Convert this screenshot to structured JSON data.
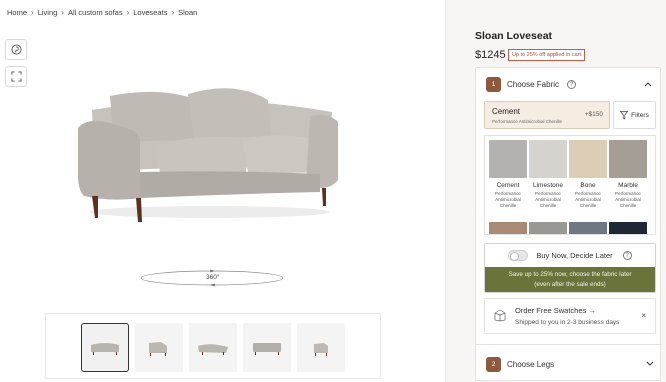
{
  "breadcrumb": [
    "Home",
    "Living",
    "All custom sofas",
    "Loveseats",
    "Sloan"
  ],
  "viewer": {
    "rotate_label": "360°"
  },
  "product": {
    "title": "Sloan Loveseat",
    "price": "$1245",
    "promo": "Up to 25% off applied in cart"
  },
  "step1": {
    "number": "1",
    "label": "Choose Fabric",
    "help": "?",
    "selected": {
      "name": "Cement",
      "desc": "Performance Antimicrobial Chenille",
      "price": "+$150"
    },
    "filters_label": "Filters",
    "swatches": [
      {
        "name": "Cement",
        "desc": [
          "Performance",
          "Antimicrobial",
          "Chenille"
        ],
        "color": "#b4b2ae"
      },
      {
        "name": "Limestone",
        "desc": [
          "Performance",
          "Antimicrobial",
          "Chenille"
        ],
        "color": "#d6d3ce"
      },
      {
        "name": "Bone",
        "desc": [
          "Performance",
          "Antimicrobial",
          "Chenille"
        ],
        "color": "#dccdb6"
      },
      {
        "name": "Marble",
        "desc": [
          "Performance",
          "Antimicrobial",
          "Chenille"
        ],
        "color": "#a59e95"
      }
    ],
    "next_row_colors": [
      "#a88b73",
      "#9a9894",
      "#6f7782",
      "#1d2736"
    ]
  },
  "buy_now": {
    "label": "Buy Now, Decide Later",
    "help": "?",
    "banner_line1": "Save up to 25% now, choose the fabric later",
    "banner_line2": "(even after the sale ends)"
  },
  "swatch_offer": {
    "title": "Order Free Swatches",
    "arrow": "→",
    "subtitle": "Shipped to you in 2-3 business days",
    "close": "×"
  },
  "step2": {
    "number": "2",
    "label": "Choose Legs"
  },
  "colors": {
    "accent": "#8c5a3c",
    "banner": "#6a7339",
    "promo": "#b84c3a",
    "sofa": "#bdb8b2"
  }
}
